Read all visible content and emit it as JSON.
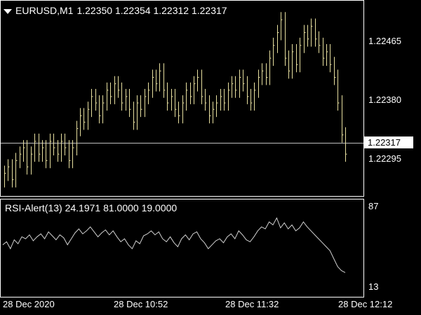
{
  "main": {
    "symbol_label": "EURUSD,M1",
    "ohlc": "1.22350 1.22354 1.22312 1.22317",
    "price_labels": [
      "1.22465",
      "1.22380",
      "1.22295"
    ],
    "current_price": "1.22317",
    "candle_color": "#e8e0a0",
    "current_line_color": "#c0c0c0",
    "grid_color": "#ffffff"
  },
  "indicator": {
    "title": "RSI-Alert(13) 24.1971 81.0000 19.0000",
    "levels": [
      "87",
      "13"
    ],
    "line_color": "#d0d0d0"
  },
  "time_labels": [
    "28 Dec 2020",
    "28 Dec 10:52",
    "28 Dec 11:32",
    "28 Dec 12:12"
  ],
  "chart_data": {
    "type": "candlestick",
    "price_range": [
      1.2226,
      1.2255
    ],
    "close": [
      1.2229,
      1.223,
      1.2228,
      1.2231,
      1.2232,
      1.2233,
      1.223,
      1.2232,
      1.2234,
      1.2232,
      1.2233,
      1.2231,
      1.2234,
      1.2233,
      1.2232,
      1.2234,
      1.2233,
      1.2231,
      1.2233,
      1.2236,
      1.2238,
      1.2237,
      1.2239,
      1.2241,
      1.224,
      1.2238,
      1.224,
      1.2242,
      1.2241,
      1.2243,
      1.2242,
      1.224,
      1.2241,
      1.2239,
      1.2237,
      1.224,
      1.2239,
      1.2241,
      1.2242,
      1.2244,
      1.2243,
      1.2245,
      1.2242,
      1.224,
      1.2241,
      1.2239,
      1.2238,
      1.224,
      1.2242,
      1.2241,
      1.2243,
      1.2244,
      1.2241,
      1.224,
      1.2238,
      1.2239,
      1.224,
      1.2241,
      1.224,
      1.2242,
      1.2243,
      1.2242,
      1.2244,
      1.2243,
      1.2241,
      1.224,
      1.2242,
      1.2244,
      1.2245,
      1.2244,
      1.2247,
      1.2249,
      1.2251,
      1.2253,
      1.2247,
      1.2245,
      1.2248,
      1.2246,
      1.2249,
      1.2251,
      1.225,
      1.2252,
      1.225,
      1.2249,
      1.2247,
      1.2248,
      1.2246,
      1.2244,
      1.224,
      1.2235,
      1.2232
    ],
    "rsi": [
      52,
      55,
      48,
      57,
      53,
      60,
      58,
      62,
      56,
      60,
      63,
      58,
      65,
      61,
      57,
      62,
      59,
      52,
      58,
      64,
      68,
      63,
      66,
      70,
      65,
      60,
      64,
      67,
      62,
      66,
      60,
      55,
      58,
      52,
      48,
      56,
      53,
      61,
      63,
      66,
      62,
      65,
      58,
      55,
      60,
      54,
      50,
      58,
      62,
      57,
      63,
      65,
      58,
      54,
      48,
      52,
      56,
      58,
      54,
      60,
      63,
      58,
      66,
      62,
      57,
      55,
      60,
      66,
      70,
      68,
      75,
      72,
      79,
      69,
      74,
      68,
      72,
      66,
      69,
      75,
      70,
      66,
      62,
      58,
      54,
      50,
      46,
      38,
      30,
      26,
      24
    ]
  }
}
